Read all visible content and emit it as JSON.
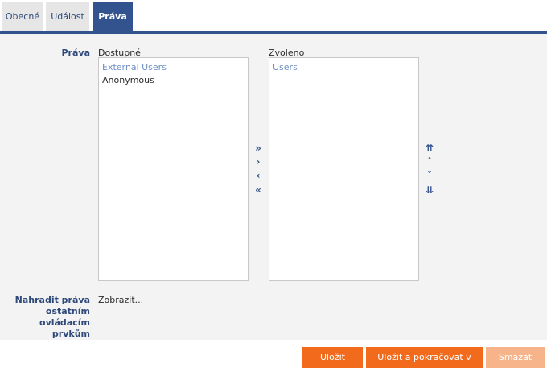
{
  "tabs": [
    {
      "label": "Obecné",
      "active": false
    },
    {
      "label": "Událost",
      "active": false
    },
    {
      "label": "Práva",
      "active": true
    }
  ],
  "form": {
    "rights_label": "Práva",
    "available_caption": "Dostupné",
    "selected_caption": "Zvoleno",
    "available_items": [
      {
        "label": "External Users",
        "type": "group"
      },
      {
        "label": "Anonymous",
        "type": "option"
      }
    ],
    "selected_items": [
      {
        "label": "Users",
        "type": "group"
      }
    ],
    "transfer_buttons": {
      "add_all": "»",
      "add": "›",
      "remove": "‹",
      "remove_all": "«"
    },
    "order_buttons": {
      "move_top": "⇈",
      "move_up": "˄",
      "move_down": "˅",
      "move_bottom": "⇊"
    },
    "replace_label_lines": [
      "Nahradit práva",
      "ostatním",
      "ovládacím",
      "prvkům"
    ],
    "show_link": "Zobrazit..."
  },
  "footer": {
    "save": "Uložit",
    "save_continue": "Uložit a pokračovat v editaci",
    "delete": "Smazat"
  },
  "colors": {
    "accent": "#33538f",
    "button": "#f26b1d",
    "button_disabled": "#f7b48a",
    "panel_bg": "#f3f3f3"
  }
}
